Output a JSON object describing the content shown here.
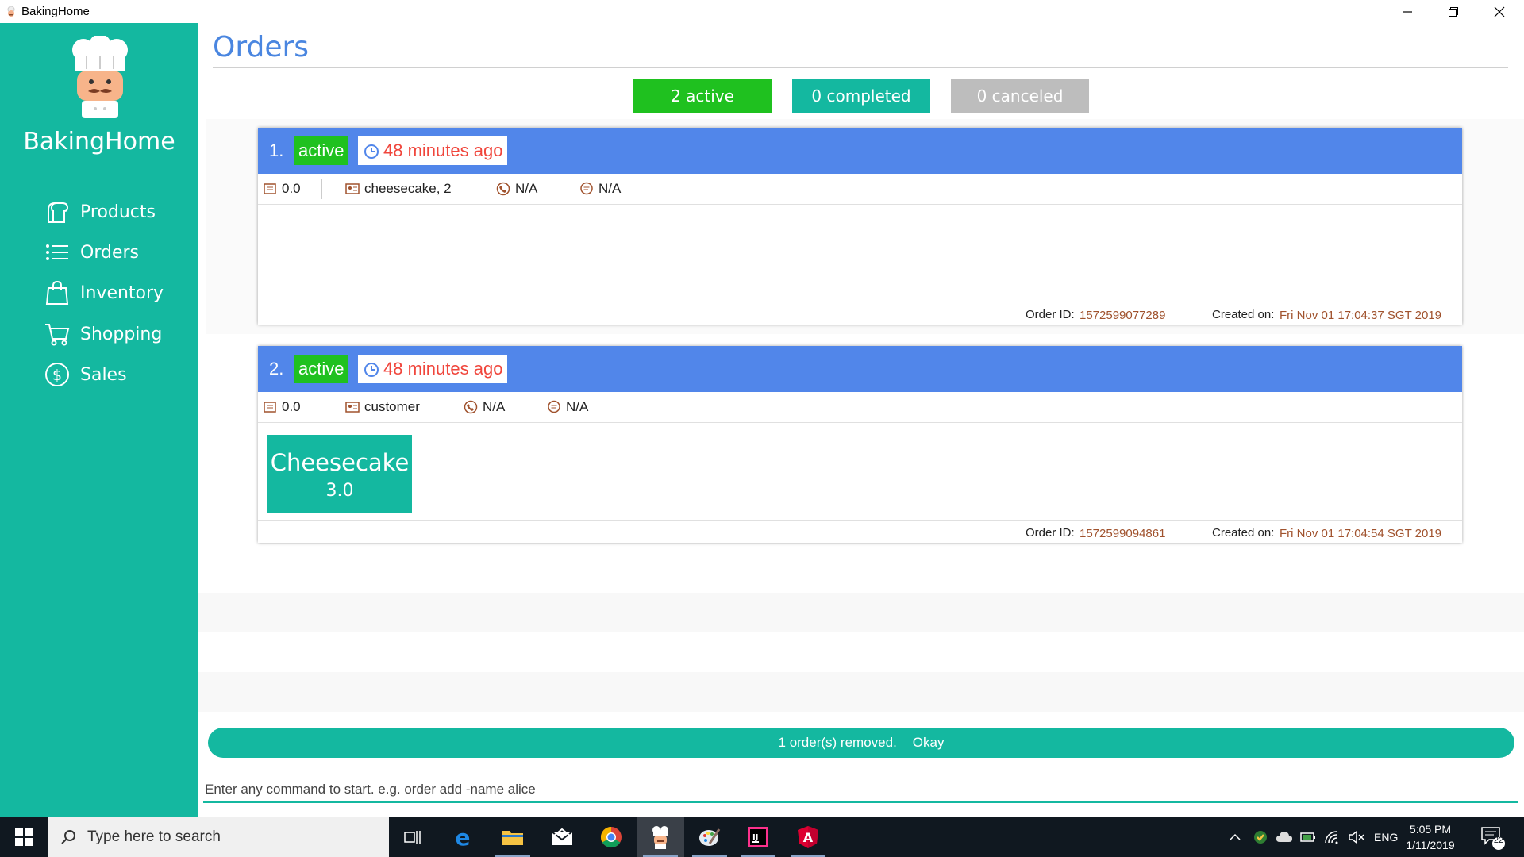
{
  "window": {
    "title": "BakingHome"
  },
  "sidebar": {
    "brand": "BakingHome",
    "items": [
      {
        "label": "Products",
        "icon": "bread-icon"
      },
      {
        "label": "Orders",
        "icon": "list-icon"
      },
      {
        "label": "Inventory",
        "icon": "bag-icon"
      },
      {
        "label": "Shopping",
        "icon": "cart-icon"
      },
      {
        "label": "Sales",
        "icon": "dollar-icon"
      }
    ]
  },
  "main": {
    "title": "Orders",
    "filters": [
      {
        "label": "2 active",
        "color": "#1fc11f"
      },
      {
        "label": "0 completed",
        "color": "#14b8a0"
      },
      {
        "label": "0 canceled",
        "color": "#bdbdbd"
      }
    ],
    "orders": [
      {
        "number": "1.",
        "status": "active",
        "time": "48 minutes ago",
        "total": "0.0",
        "customer": "cheesecake, 2",
        "phone": "N/A",
        "remark": "N/A",
        "order_id_label": "Order ID:",
        "order_id": "1572599077289",
        "created_label": "Created on:",
        "created": "Fri Nov 01 17:04:37 SGT 2019",
        "items": []
      },
      {
        "number": "2.",
        "status": "active",
        "time": "48 minutes ago",
        "total": "0.0",
        "customer": "customer",
        "phone": "N/A",
        "remark": "N/A",
        "order_id_label": "Order ID:",
        "order_id": "1572599094861",
        "created_label": "Created on:",
        "created": "Fri Nov 01 17:04:54 SGT 2019",
        "items": [
          {
            "name": "Cheesecake",
            "qty": "3.0"
          }
        ]
      }
    ],
    "status_message": "1 order(s) removed.",
    "status_action": "Okay",
    "command": {
      "placeholder": "Enter any command to start. e.g. order add -name alice",
      "value": ""
    }
  },
  "taskbar": {
    "search_placeholder": "Type here to search",
    "language": "ENG",
    "time": "5:05 PM",
    "date": "1/11/2019",
    "notifications": "22"
  },
  "colors": {
    "sidebar": "#14b8a0",
    "header": "#5186ea",
    "title": "#4a86e0",
    "active": "#1fc11f",
    "time_text": "#f0463c"
  }
}
